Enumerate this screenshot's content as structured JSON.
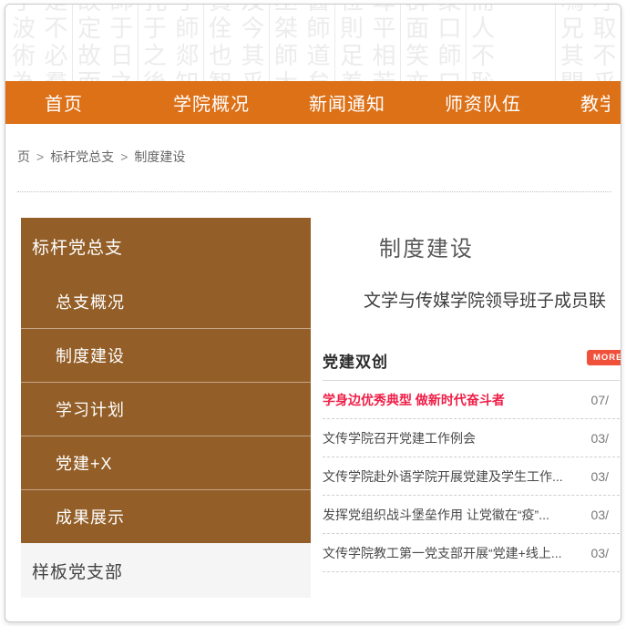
{
  "colors": {
    "nav_bg": "#dd7118",
    "sidebar_bg": "#935e27",
    "badge_bg": "#f0513b",
    "highlight_text": "#ef1e47"
  },
  "calligraphy": {
    "columns": [
      "乎波術為",
      "是不必羣",
      "故定故而",
      "師于日之",
      "孔于之後",
      "子師郯知",
      "賢佺也智",
      "及今其乎",
      "巫桀師大",
      "醫師道矣",
      "位則足羞",
      "卑平相若",
      "群面笑亦",
      "聚口師曰",
      "而人不恥",
      "",
      "嗚兄其問",
      "呼取不乎"
    ]
  },
  "nav": {
    "items": [
      "首页",
      "学院概况",
      "新闻通知",
      "师资队伍",
      "教学"
    ]
  },
  "breadcrumb": {
    "separator": ">",
    "items": [
      "页",
      "标杆党总支",
      "制度建设"
    ]
  },
  "sidebar": {
    "title": "标杆党总支",
    "items": [
      "总支概况",
      "制度建设",
      "学习计划",
      "党建+X",
      "成果展示"
    ],
    "footer_item": "样板党支部"
  },
  "main": {
    "page_title": "制度建设",
    "featured_link": "文学与传媒学院领导班子成员联",
    "section": {
      "title": "党建双创",
      "more_label": "MORE",
      "news": [
        {
          "title": "学身边优秀典型 做新时代奋斗者",
          "date": "07/",
          "highlight": true
        },
        {
          "title": "文传学院召开党建工作例会",
          "date": "03/",
          "highlight": false
        },
        {
          "title": "文传学院赴外语学院开展党建及学生工作...",
          "date": "03/",
          "highlight": false
        },
        {
          "title": "发挥党组织战斗堡垒作用 让党徽在“疫”...",
          "date": "03/",
          "highlight": false
        },
        {
          "title": "文传学院教工第一党支部开展“党建+线上...",
          "date": "03/",
          "highlight": false
        }
      ]
    }
  }
}
